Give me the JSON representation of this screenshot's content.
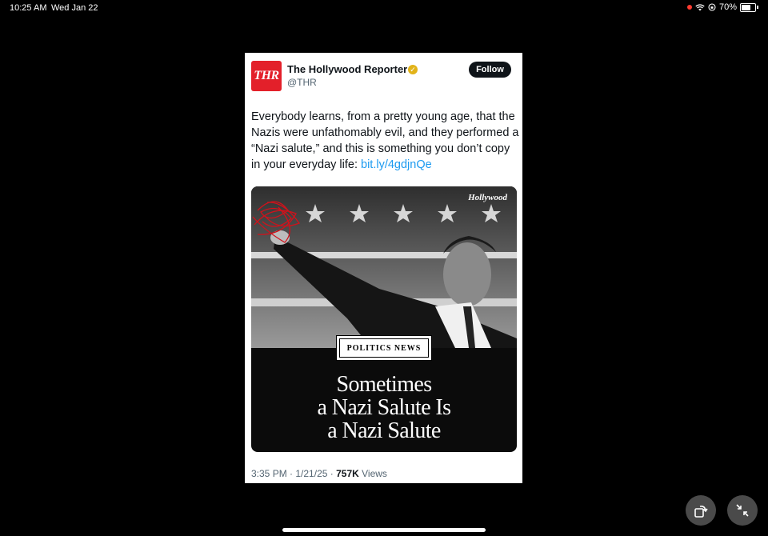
{
  "status_bar": {
    "time": "10:25 AM",
    "date": "Wed Jan 22",
    "battery": "70%",
    "battery_level": 0.7
  },
  "tweet": {
    "avatar_text": "THR",
    "author_name": "The Hollywood Reporter",
    "handle": "@THR",
    "follow_label": "Follow",
    "text": "Everybody learns, from a pretty young age, that the Nazis were unfathomably evil, and they performed a “Nazi salute,” and this is something you don’t copy in your everyday life: ",
    "link": "bit.ly/4gdjnQe",
    "media": {
      "brand": "Hollywood",
      "category": "POLITICS NEWS",
      "headline_lines": [
        "Sometimes",
        "a Nazi Salute Is",
        "a Nazi Salute"
      ]
    },
    "time": "3:35 PM",
    "date": "1/21/25",
    "views_count": "757K",
    "views_label": "Views"
  },
  "controls": {
    "rotate_icon": "rotate-icon",
    "minimize_icon": "minimize-icon"
  },
  "colors": {
    "thr_red": "#e3202a",
    "link_blue": "#1d9bf0",
    "verified_gold": "#e2b319"
  }
}
